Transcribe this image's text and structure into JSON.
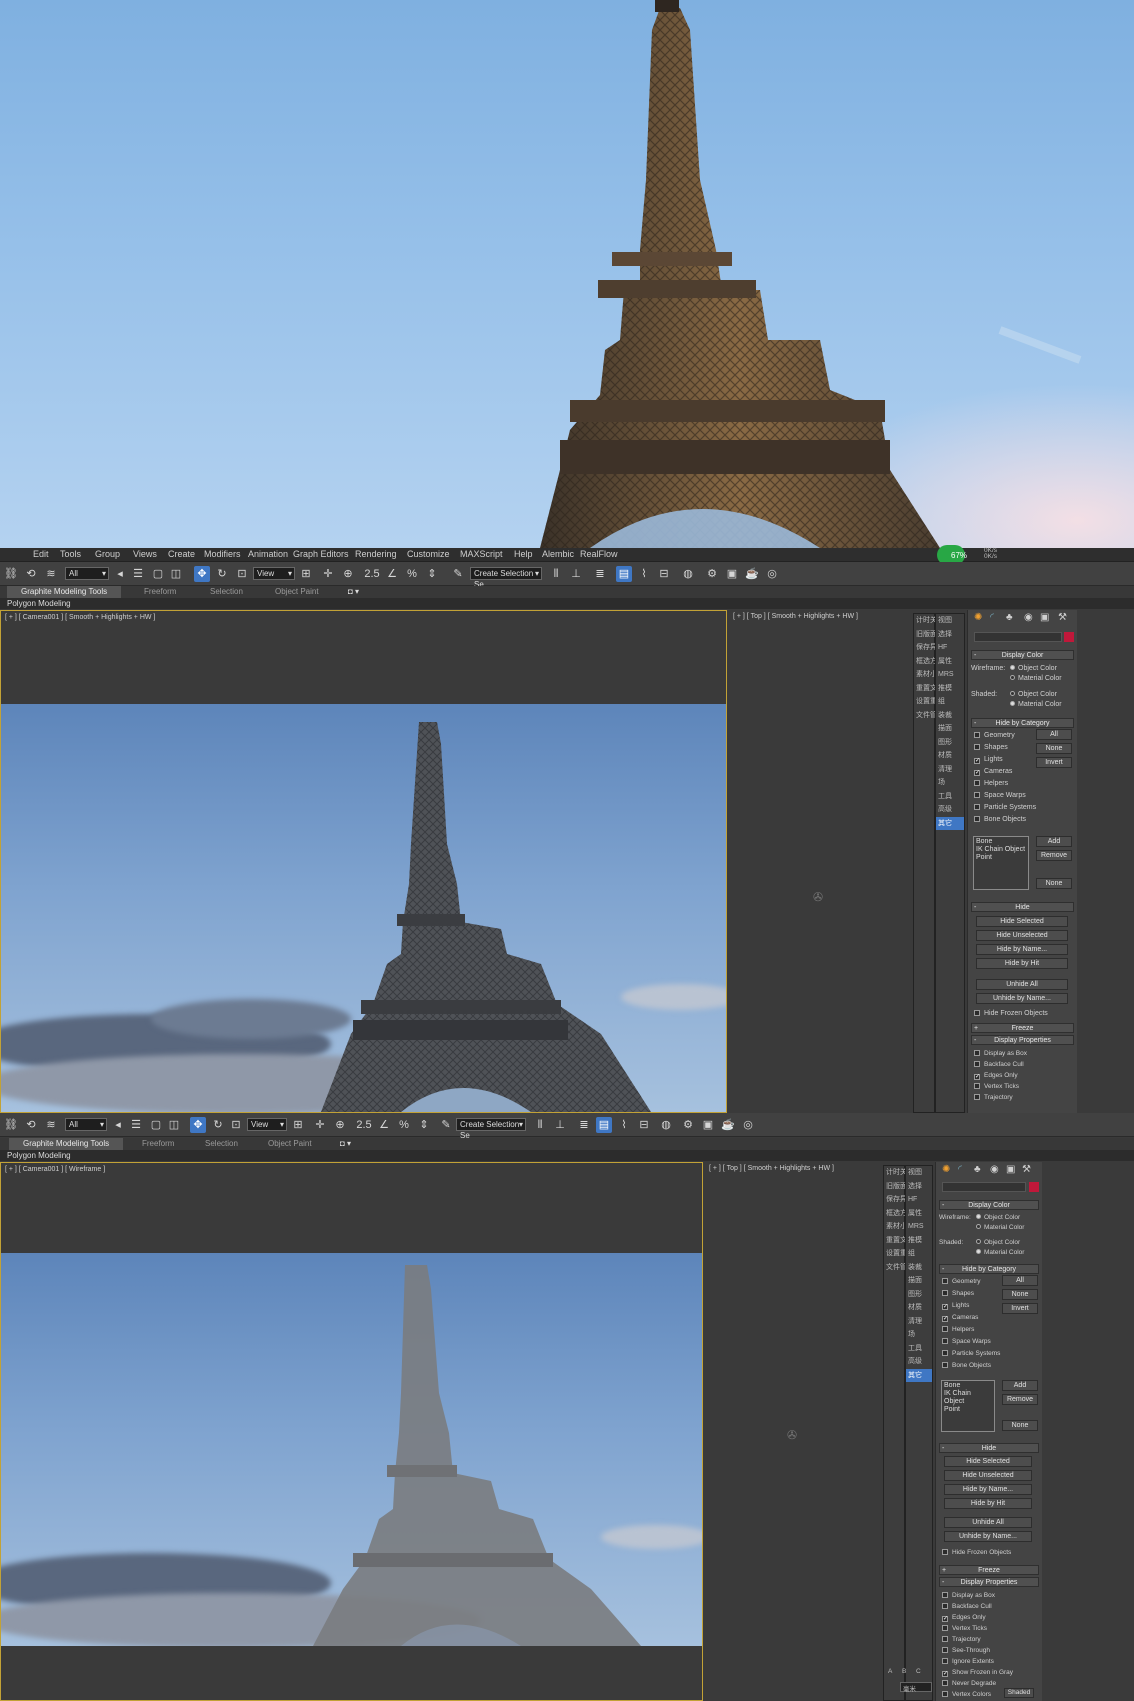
{
  "menu": {
    "items": [
      "Edit",
      "Tools",
      "Group",
      "Views",
      "Create",
      "Modifiers",
      "Animation",
      "Graph Editors",
      "Rendering",
      "Customize",
      "MAXScript",
      "Help",
      "Alembic",
      "RealFlow"
    ]
  },
  "toolbar": {
    "filter_value": "All",
    "refcoord_value": "View",
    "snap_label": "2.5",
    "selection_set_placeholder": "Create Selection Se",
    "cpu_percent": "67%",
    "net_up": "0K/s",
    "net_down": "0K/s"
  },
  "ribbon": {
    "tabs": [
      "Graphite Modeling Tools",
      "Freeform",
      "Selection",
      "Object Paint"
    ],
    "active_tab": "Graphite Modeling Tools",
    "sub_label": "Polygon Modeling"
  },
  "viewport1": {
    "label": "[ + ] [ Camera001 ] [ Smooth + Highlights + HW ]",
    "top_label": "[ + ] [ Top ]  [ Smooth + Highlights + HW ]"
  },
  "viewport2": {
    "label": "[ + ] [ Camera001 ] [ Wireframe ]",
    "top_label": "[ + ] [ Top ]  [ Smooth + Highlights + HW ]"
  },
  "command_list": [
    "计时关机",
    "旧版面板",
    "保存异常",
    "框选方向",
    "素材小伴",
    "重置文件",
    "设置重位",
    "文件管理"
  ],
  "command_list2": [
    "视图",
    "选择",
    "HF",
    "属性",
    "MRS",
    "推模",
    "组",
    "装裁",
    "描面",
    "图形",
    "材质",
    "清理",
    "场",
    "工具",
    "高级",
    "其它"
  ],
  "display_panel": {
    "display_color": {
      "title": "Display Color",
      "wireframe_label": "Wireframe:",
      "shaded_label": "Shaded:",
      "object_color": "Object Color",
      "material_color": "Material Color"
    },
    "hide_by_category": {
      "title": "Hide by Category",
      "items": [
        {
          "label": "Geometry",
          "checked": false
        },
        {
          "label": "Shapes",
          "checked": false
        },
        {
          "label": "Lights",
          "checked": true
        },
        {
          "label": "Cameras",
          "checked": true
        },
        {
          "label": "Helpers",
          "checked": false
        },
        {
          "label": "Space Warps",
          "checked": false
        },
        {
          "label": "Particle Systems",
          "checked": false
        },
        {
          "label": "Bone Objects",
          "checked": false
        }
      ],
      "btn_all": "All",
      "btn_none": "None",
      "btn_invert": "Invert",
      "list_items": [
        "Bone",
        "IK Chain Object",
        "Point"
      ],
      "btn_add": "Add",
      "btn_remove": "Remove",
      "btn_none2": "None"
    },
    "hide": {
      "title": "Hide",
      "buttons": [
        "Hide Selected",
        "Hide Unselected",
        "Hide by Name...",
        "Hide by Hit",
        "Unhide All",
        "Unhide by Name..."
      ],
      "hide_frozen": "Hide Frozen Objects"
    },
    "freeze": {
      "title": "Freeze"
    },
    "display_properties": {
      "title": "Display Properties",
      "items": [
        {
          "label": "Display as Box",
          "checked": false
        },
        {
          "label": "Backface Cull",
          "checked": false
        },
        {
          "label": "Edges Only",
          "checked": true
        },
        {
          "label": "Vertex Ticks",
          "checked": false
        },
        {
          "label": "Trajectory",
          "checked": false
        },
        {
          "label": "See-Through",
          "checked": false
        },
        {
          "label": "Ignore Extents",
          "checked": false
        },
        {
          "label": "Show Frozen in Gray",
          "checked": true
        },
        {
          "label": "Never Degrade",
          "checked": false
        },
        {
          "label": "Vertex Colors",
          "checked": false
        }
      ],
      "shaded_btn": "Shaded"
    }
  },
  "bottom_left": {
    "letters": [
      "A",
      "B",
      "C"
    ],
    "unit_value": "毫米"
  }
}
